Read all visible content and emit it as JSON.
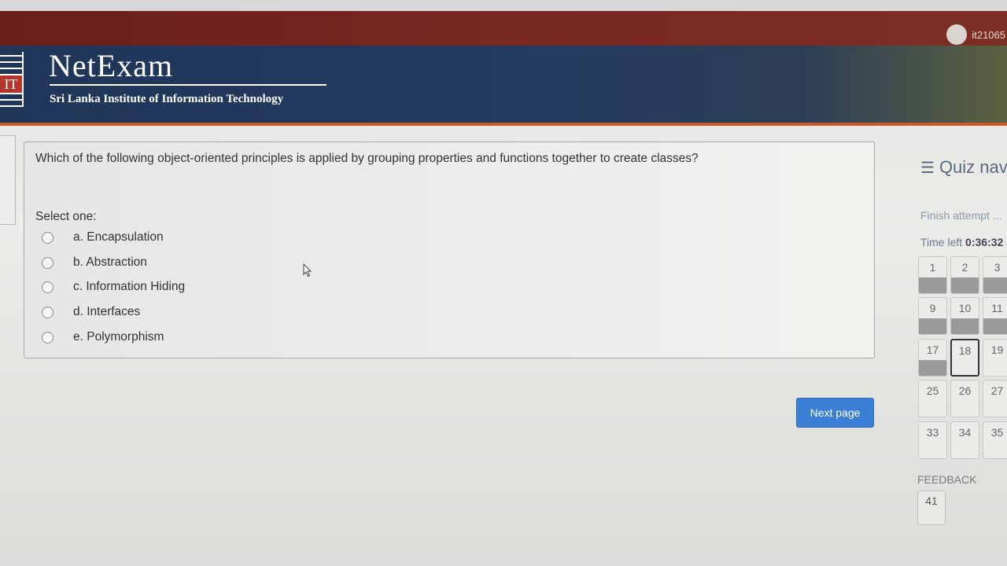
{
  "user": {
    "name": "it21065"
  },
  "header": {
    "brand": "NetExam",
    "subtitle": "Sri Lanka Institute of Information Technology",
    "logo_text": "IT"
  },
  "question": {
    "text": "Which of the following object-oriented principles is applied by grouping properties and functions together to create classes?",
    "prompt": "Select one:",
    "options": [
      {
        "label": "a. Encapsulation",
        "selected": false
      },
      {
        "label": "b. Abstraction",
        "selected": false
      },
      {
        "label": "c. Information Hiding",
        "selected": false
      },
      {
        "label": "d. Interfaces",
        "selected": false
      },
      {
        "label": "e. Polymorphism",
        "selected": false
      }
    ]
  },
  "actions": {
    "next_label": "Next page"
  },
  "quiz_nav": {
    "title": "Quiz nav",
    "finish_label": "Finish attempt ...",
    "time_label": "Time left",
    "time_value": "0:36:32",
    "questions": [
      {
        "num": "1",
        "answered": true
      },
      {
        "num": "2",
        "answered": true
      },
      {
        "num": "3",
        "answered": true
      },
      {
        "num": "9",
        "answered": true
      },
      {
        "num": "10",
        "answered": true
      },
      {
        "num": "11",
        "answered": true
      },
      {
        "num": "17",
        "answered": true
      },
      {
        "num": "18",
        "answered": false,
        "current": true
      },
      {
        "num": "19",
        "answered": false
      },
      {
        "num": "25",
        "answered": false
      },
      {
        "num": "26",
        "answered": false
      },
      {
        "num": "27",
        "answered": false
      },
      {
        "num": "33",
        "answered": false
      },
      {
        "num": "34",
        "answered": false
      },
      {
        "num": "35",
        "answered": false
      }
    ],
    "feedback_label": "FEEDBACK",
    "feedback_num": "41"
  },
  "colors": {
    "topbar": "#6a1f1a",
    "header": "#1f3659",
    "accent_line": "#c75a2a",
    "button": "#3c7fd6"
  }
}
